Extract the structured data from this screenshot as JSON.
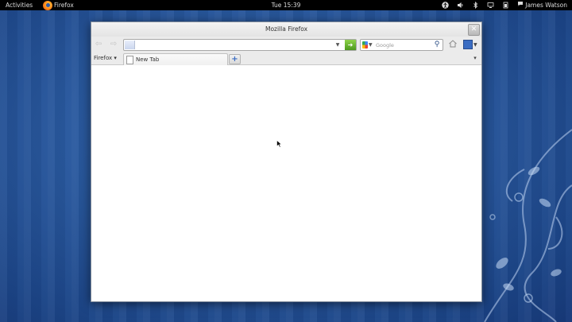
{
  "topbar": {
    "activities": "Activities",
    "app_name": "Firefox",
    "clock": "Tue 15:39",
    "user_name": "James Watson",
    "tray_icons": [
      "accessibility-icon",
      "volume-icon",
      "bluetooth-icon",
      "network-icon",
      "power-icon"
    ]
  },
  "window": {
    "title": "Mozilla Firefox"
  },
  "navbar": {
    "url_value": "",
    "search_placeholder": "Google",
    "search_engine": "Google"
  },
  "tabbar": {
    "menu_label": "Firefox",
    "tabs": [
      {
        "label": "New Tab"
      }
    ]
  }
}
